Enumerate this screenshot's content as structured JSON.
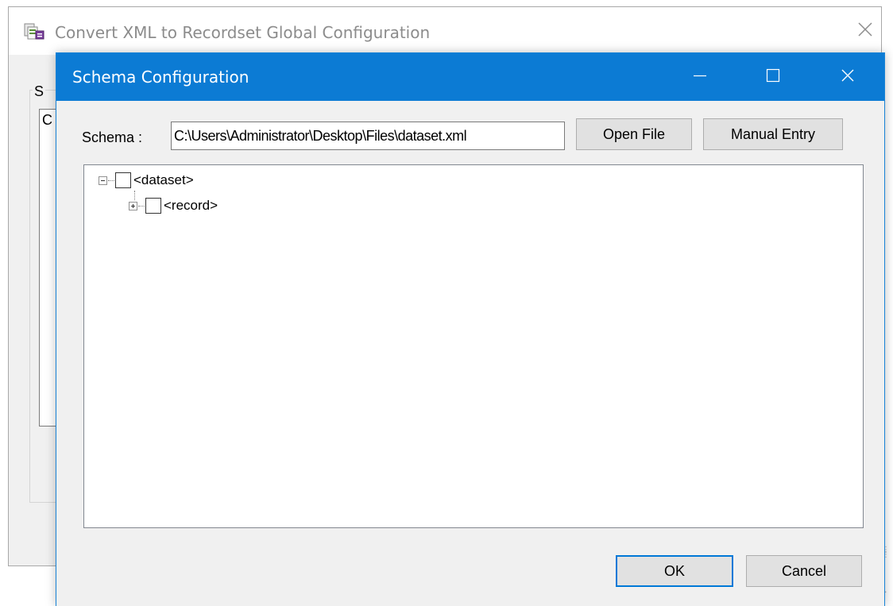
{
  "parent_window": {
    "title": "Convert XML to Recordset Global Configuration",
    "group_label_fragment": "S",
    "list_text_fragment": "C",
    "icons": {
      "app": "xml-recordset-app-icon",
      "close": "close-icon"
    }
  },
  "dialog": {
    "title": "Schema Configuration",
    "caption_icons": [
      "minimize-icon",
      "maximize-icon",
      "close-icon"
    ],
    "schema_label": "Schema :",
    "schema_path": "C:\\Users\\Administrator\\Desktop\\Files\\dataset.xml",
    "open_file_label": "Open File",
    "manual_entry_label": "Manual Entry",
    "tree": {
      "nodes": [
        {
          "label": "<dataset>",
          "expanded": true,
          "checked": false
        },
        {
          "label": "<record>",
          "expanded": false,
          "checked": false
        }
      ]
    },
    "ok_label": "OK",
    "cancel_label": "Cancel"
  },
  "colors": {
    "titlebar_accent": "#0c7bd4",
    "window_bg": "#f0f0f0",
    "default_button_border": "#0078d7"
  }
}
